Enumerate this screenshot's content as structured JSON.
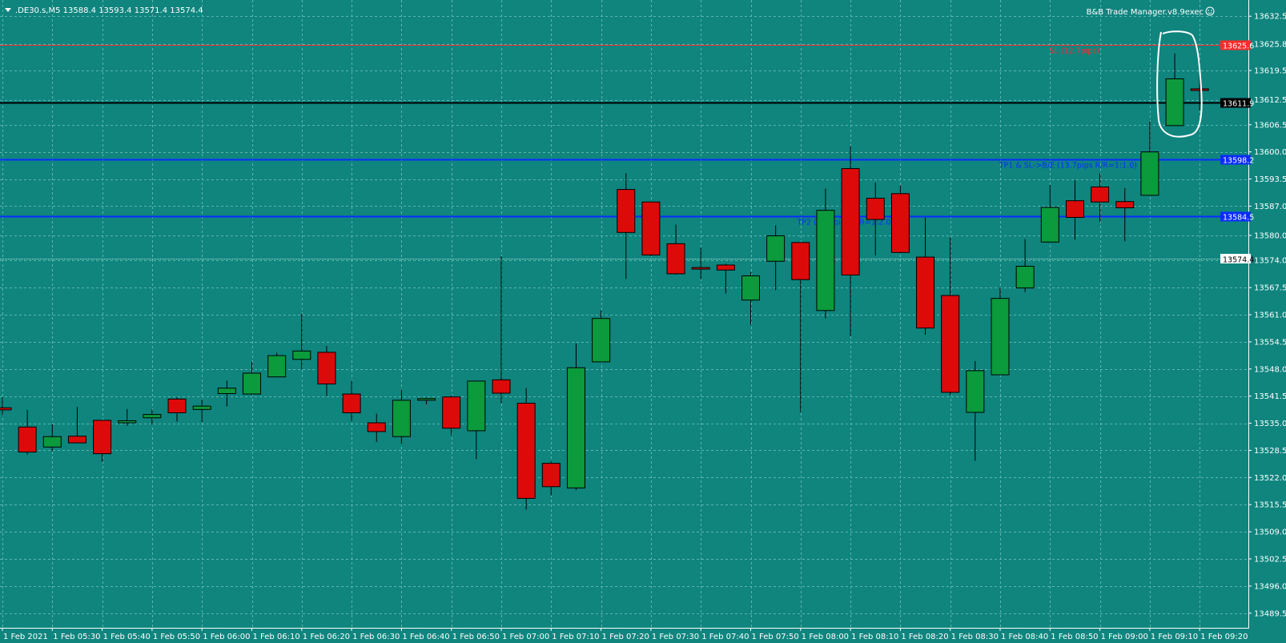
{
  "header": {
    "symbol_info": ".DE30.s,M5  13588.4 13593.4 13571.4 13574.4",
    "expert_label": "B&B Trade Manager.v8.9exec"
  },
  "colors": {
    "background": "#0f857e",
    "bull": "#0b9a3c",
    "bear": "#dd0a0a",
    "grid": "#5fb5ae",
    "axis_text": "#ffffff"
  },
  "icons": [
    "dropdown-triangle-icon",
    "smiley-icon"
  ],
  "levels": [
    {
      "id": "sl",
      "price": 13625.6,
      "color": "#ff2b2b",
      "tag": "13625.6",
      "label": "SL (12.7pips)"
    },
    {
      "id": "entry",
      "price": 13611.9,
      "color": "#000000",
      "tag": "13611.9",
      "label": ""
    },
    {
      "id": "tp1",
      "price": 13598.2,
      "color": "#0a2cff",
      "tag": "13598.2",
      "label": "TP1 & SL->B/E (13.7pips R/R=1:1.0)"
    },
    {
      "id": "tp2",
      "price": 13584.5,
      "color": "#0a2cff",
      "tag": "13584.5",
      "label": "TP2 (27.4pips R/R=1:2.0)"
    }
  ],
  "current_price": "13574.4",
  "chart_data": {
    "type": "candlestick",
    "symbol": ".DE30.s",
    "timeframe": "M5",
    "ylim": [
      13486,
      13636
    ],
    "y_ticks": [
      "13632.5",
      "13625.8",
      "13619.5",
      "13612.5",
      "13606.5",
      "13600.0",
      "13593.5",
      "13587.0",
      "13580.0",
      "13574.0",
      "13567.5",
      "13561.0",
      "13554.5",
      "13548.0",
      "13541.5",
      "13535.0",
      "13528.5",
      "13522.0",
      "13515.5",
      "13509.0",
      "13502.5",
      "13496.0",
      "13489.5"
    ],
    "x_tick_labels": [
      "1 Feb 2021",
      "1 Feb 05:30",
      "1 Feb 05:40",
      "1 Feb 05:50",
      "1 Feb 06:00",
      "1 Feb 06:10",
      "1 Feb 06:20",
      "1 Feb 06:30",
      "1 Feb 06:40",
      "1 Feb 06:50",
      "1 Feb 07:00",
      "1 Feb 07:10",
      "1 Feb 07:20",
      "1 Feb 07:30",
      "1 Feb 07:40",
      "1 Feb 07:50",
      "1 Feb 08:00",
      "1 Feb 08:10",
      "1 Feb 08:20",
      "1 Feb 08:30",
      "1 Feb 08:40",
      "1 Feb 08:50",
      "1 Feb 09:00",
      "1 Feb 09:10",
      "1 Feb 09:20"
    ],
    "candles": [
      {
        "o": 13538.7,
        "h": 13541.2,
        "l": 13536.9,
        "c": 13538.2
      },
      {
        "o": 13534.1,
        "h": 13538.2,
        "l": 13527.5,
        "c": 13528.1
      },
      {
        "o": 13529.3,
        "h": 13534.8,
        "l": 13528.3,
        "c": 13531.8
      },
      {
        "o": 13531.9,
        "h": 13538.9,
        "l": 13530.8,
        "c": 13530.3
      },
      {
        "o": 13535.7,
        "h": 13535.7,
        "l": 13525.7,
        "c": 13527.7
      },
      {
        "o": 13535.1,
        "h": 13538.4,
        "l": 13534.4,
        "c": 13535.6
      },
      {
        "o": 13536.3,
        "h": 13538.3,
        "l": 13534.6,
        "c": 13537.1
      },
      {
        "o": 13540.8,
        "h": 13541.2,
        "l": 13535.4,
        "c": 13537.5
      },
      {
        "o": 13538.3,
        "h": 13540.7,
        "l": 13535.3,
        "c": 13539.1
      },
      {
        "o": 13542.1,
        "h": 13545.2,
        "l": 13539.0,
        "c": 13543.4
      },
      {
        "o": 13542.0,
        "h": 13549.7,
        "l": 13541.7,
        "c": 13547.0
      },
      {
        "o": 13546.1,
        "h": 13551.9,
        "l": 13546.1,
        "c": 13551.2
      },
      {
        "o": 13550.3,
        "h": 13561.2,
        "l": 13548.0,
        "c": 13552.3
      },
      {
        "o": 13552.0,
        "h": 13553.5,
        "l": 13541.5,
        "c": 13544.4
      },
      {
        "o": 13542.0,
        "h": 13545.2,
        "l": 13535.5,
        "c": 13537.5
      },
      {
        "o": 13535.1,
        "h": 13537.3,
        "l": 13530.5,
        "c": 13533.0
      },
      {
        "o": 13531.8,
        "h": 13543.0,
        "l": 13530.0,
        "c": 13540.5
      },
      {
        "o": 13540.8,
        "h": 13541.1,
        "l": 13539.5,
        "c": 13540.9
      },
      {
        "o": 13541.3,
        "h": 13541.7,
        "l": 13532.1,
        "c": 13533.8
      },
      {
        "o": 13533.2,
        "h": 13545.1,
        "l": 13526.4,
        "c": 13545.1
      },
      {
        "o": 13545.4,
        "h": 13575.0,
        "l": 13539.8,
        "c": 13542.2
      },
      {
        "o": 13539.8,
        "h": 13543.4,
        "l": 13514.3,
        "c": 13517.0
      },
      {
        "o": 13525.4,
        "h": 13525.9,
        "l": 13517.7,
        "c": 13519.8
      },
      {
        "o": 13519.5,
        "h": 13554.1,
        "l": 13519.0,
        "c": 13548.3
      },
      {
        "o": 13549.7,
        "h": 13562.0,
        "l": 13549.7,
        "c": 13560.1
      },
      {
        "o": 13591.0,
        "h": 13594.9,
        "l": 13569.5,
        "c": 13580.7
      },
      {
        "o": 13588.0,
        "h": 13588.0,
        "l": 13575.0,
        "c": 13575.3
      },
      {
        "o": 13578.0,
        "h": 13582.6,
        "l": 13570.6,
        "c": 13570.8
      },
      {
        "o": 13572.3,
        "h": 13577.1,
        "l": 13569.5,
        "c": 13572.0
      },
      {
        "o": 13572.9,
        "h": 13573.2,
        "l": 13566.1,
        "c": 13571.7
      },
      {
        "o": 13564.5,
        "h": 13571.2,
        "l": 13558.6,
        "c": 13570.3
      },
      {
        "o": 13573.8,
        "h": 13582.4,
        "l": 13566.9,
        "c": 13579.9
      },
      {
        "o": 13578.3,
        "h": 13578.3,
        "l": 13537.7,
        "c": 13569.4
      },
      {
        "o": 13562.0,
        "h": 13591.2,
        "l": 13560.1,
        "c": 13586.0
      },
      {
        "o": 13596.0,
        "h": 13601.4,
        "l": 13555.9,
        "c": 13570.5
      },
      {
        "o": 13588.9,
        "h": 13592.7,
        "l": 13575.2,
        "c": 13583.8
      },
      {
        "o": 13590.0,
        "h": 13591.9,
        "l": 13576.3,
        "c": 13575.9
      },
      {
        "o": 13574.8,
        "h": 13584.3,
        "l": 13556.2,
        "c": 13557.8
      },
      {
        "o": 13565.6,
        "h": 13579.5,
        "l": 13541.6,
        "c": 13542.4
      },
      {
        "o": 13537.6,
        "h": 13549.9,
        "l": 13526.0,
        "c": 13547.6
      },
      {
        "o": 13546.6,
        "h": 13567.5,
        "l": 13546.6,
        "c": 13564.9
      },
      {
        "o": 13567.4,
        "h": 13579.1,
        "l": 13566.4,
        "c": 13572.6
      },
      {
        "o": 13578.4,
        "h": 13592.1,
        "l": 13578.4,
        "c": 13586.7
      },
      {
        "o": 13588.3,
        "h": 13593.2,
        "l": 13579.0,
        "c": 13584.3
      },
      {
        "o": 13591.6,
        "h": 13594.9,
        "l": 13583.2,
        "c": 13588.0
      },
      {
        "o": 13588.1,
        "h": 13591.3,
        "l": 13578.6,
        "c": 13586.6
      },
      {
        "o": 13589.6,
        "h": 13607.3,
        "l": 13589.6,
        "c": 13600.0
      },
      {
        "o": 13606.3,
        "h": 13623.6,
        "l": 13606.3,
        "c": 13617.5
      },
      {
        "o": 13615.1,
        "h": 13621.8,
        "l": 13609.9,
        "c": 13614.8
      }
    ]
  }
}
